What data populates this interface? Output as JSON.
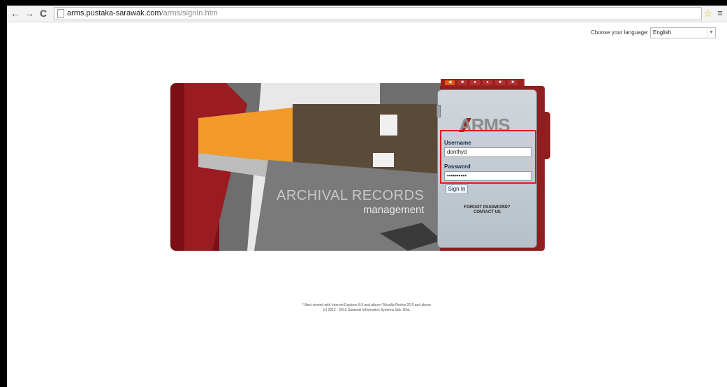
{
  "browser": {
    "back": "←",
    "forward": "→",
    "reload": "C",
    "url_host": "arms.pustaka-sarawak.com",
    "url_path": "/arms/signIn.htm",
    "star": "☆",
    "menu": "≡"
  },
  "language": {
    "label": "Choose your language:",
    "selected": "English"
  },
  "banner": {
    "title": "ARCHIVAL RECORDS",
    "subtitle": "management"
  },
  "panel": {
    "logo": "ARMS",
    "username_label": "Username",
    "username_value": "donthyd",
    "password_label": "Password",
    "password_value": "••••••••••",
    "signin_label": "Sign In",
    "forgot_label": "FORGOT PASSWORD?",
    "contact_label": "CONTACT US"
  },
  "footer": {
    "line1": "* Best viewed with Internet Explorer 8.0 and above / Mozilla Firefox 20.0 and above",
    "line2": "(c) 2012 - 2013 Sarawak Information Systems Sdn. Bhd."
  },
  "colors": {
    "brand_red": "#9c2020",
    "highlight": "#e21a1a"
  }
}
